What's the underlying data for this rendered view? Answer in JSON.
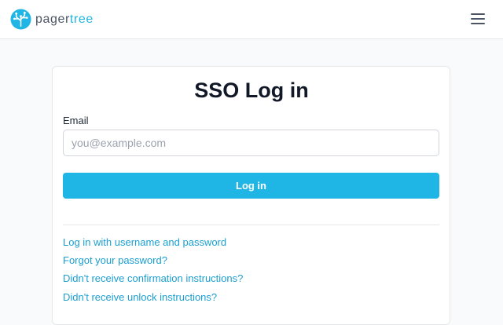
{
  "header": {
    "brand_pager": "pager",
    "brand_tree": "tree",
    "logo_icon": "pagertree-tree-logo-icon",
    "menu_icon": "hamburger-menu-icon"
  },
  "form": {
    "title": "SSO Log in",
    "email_label": "Email",
    "email_placeholder": "you@example.com",
    "email_value": "",
    "submit_label": "Log in"
  },
  "links": [
    "Log in with username and password",
    "Forgot your password?",
    "Didn't receive confirmation instructions?",
    "Didn't receive unlock instructions?"
  ],
  "colors": {
    "accent": "#1fb6e6",
    "link": "#1b9fd0"
  }
}
